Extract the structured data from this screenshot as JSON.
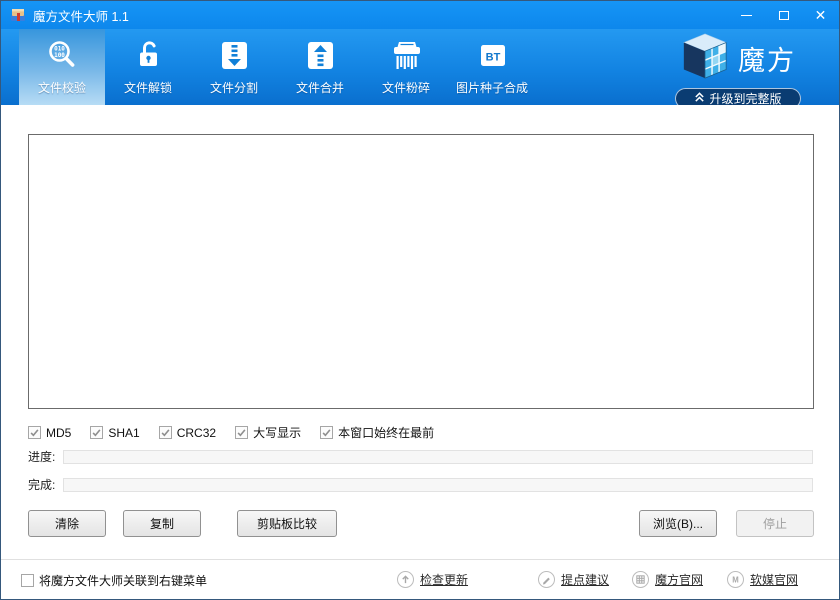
{
  "window": {
    "title": "魔方文件大师 1.1",
    "controls": {
      "minimize": "minimize",
      "maximize": "maximize",
      "close": "close"
    }
  },
  "toolbar": {
    "tabs": [
      {
        "label": "文件校验",
        "icon": "checksum-magnifier-icon",
        "active": true
      },
      {
        "label": "文件解锁",
        "icon": "unlock-padlock-icon",
        "active": false
      },
      {
        "label": "文件分割",
        "icon": "split-zipper-down-icon",
        "active": false
      },
      {
        "label": "文件合并",
        "icon": "merge-zipper-up-icon",
        "active": false
      },
      {
        "label": "文件粉碎",
        "icon": "shredder-icon",
        "active": false
      },
      {
        "label": "图片种子合成",
        "icon": "bt-badge-icon",
        "active": false
      }
    ],
    "brand": {
      "logo_text": "魔方",
      "upgrade_label": "升级到完整版"
    }
  },
  "main": {
    "file_list": {
      "items": []
    },
    "options": [
      {
        "label": "MD5",
        "checked": true
      },
      {
        "label": "SHA1",
        "checked": true
      },
      {
        "label": "CRC32",
        "checked": true
      },
      {
        "label": "大写显示",
        "checked": true
      },
      {
        "label": "本窗口始终在最前",
        "checked": true
      }
    ],
    "progress": [
      {
        "label": "进度:",
        "value_percent": 0
      },
      {
        "label": "完成:",
        "value_percent": 0
      }
    ],
    "buttons": {
      "clear": "清除",
      "copy": "复制",
      "clipboard_compare": "剪贴板比较",
      "browse": "浏览(B)...",
      "stop": "停止",
      "stop_disabled": true
    }
  },
  "statusbar": {
    "associate_checkbox": {
      "label": "将魔方文件大师关联到右键菜单",
      "checked": false
    },
    "links": [
      {
        "label": "检查更新",
        "icon": "update-arrow-icon"
      },
      {
        "label": "提点建议",
        "icon": "suggestion-pencil-icon"
      },
      {
        "label": "魔方官网",
        "icon": "mofang-grid-icon"
      },
      {
        "label": "软媒官网",
        "icon": "ruanmei-m-icon"
      }
    ]
  },
  "colors": {
    "titlebar_blue": "#0e8cf0",
    "toolbar_top": "#2499f1",
    "toolbar_bottom": "#0a6fce",
    "selected_tab_bottom": "#b7dcf5",
    "upgrade_button_bg": "#0a3c72",
    "icon_accent_blue": "#1180d8"
  }
}
